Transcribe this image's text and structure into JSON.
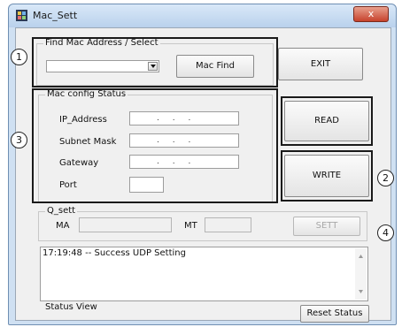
{
  "window": {
    "title": "Mac_Sett",
    "close_glyph": "x",
    "app_icon": "app-icon"
  },
  "find_group": {
    "legend": "Find Mac Address / Select",
    "combo_value": "",
    "mac_find_label": "Mac Find"
  },
  "exit_label": "EXIT",
  "config_group": {
    "legend": "Mac config Status",
    "ip_label": "IP_Address",
    "subnet_label": "Subnet Mask",
    "gateway_label": "Gateway",
    "port_label": "Port",
    "ip_dots": ".   .   .",
    "port_value": ""
  },
  "read_label": "READ",
  "write_label": "WRITE",
  "q_group": {
    "legend": "Q_sett",
    "ma_label": "MA",
    "mt_label": "MT",
    "ma_value": "",
    "mt_value": "",
    "sett_label": "SETT"
  },
  "status": {
    "log_line": "17:19:48 -- Success UDP Setting",
    "view_label": "Status View",
    "reset_label": "Reset Status"
  },
  "markers": {
    "m1": "1",
    "m2": "2",
    "m3": "3",
    "m4": "4"
  }
}
